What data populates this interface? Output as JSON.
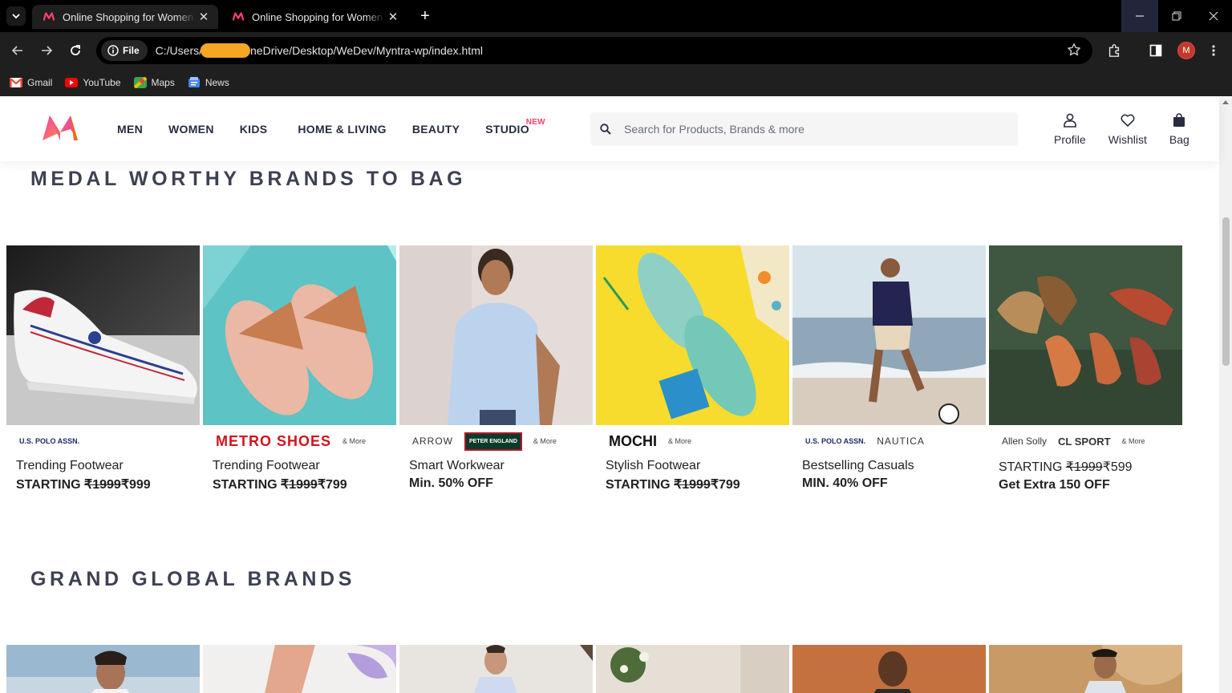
{
  "browser": {
    "tabs": [
      {
        "title": "Online Shopping for Women, M",
        "active": true
      },
      {
        "title": "Online Shopping for Women, M",
        "active": false
      }
    ],
    "address": {
      "chip": "File",
      "url_start": "C:/Users/",
      "url_end": "neDrive/Desktop/WeDev/Myntra-wp/index.html"
    },
    "profile_initial": "M",
    "bookmarks": [
      {
        "label": "Gmail",
        "icon": "gmail-icon",
        "color": "#ea4335"
      },
      {
        "label": "YouTube",
        "icon": "youtube-icon",
        "color": "#ff0000"
      },
      {
        "label": "Maps",
        "icon": "maps-icon",
        "color": "#34a853"
      },
      {
        "label": "News",
        "icon": "news-icon",
        "color": "#4285f4"
      }
    ]
  },
  "site": {
    "accent": "#ff3f6c",
    "nav": [
      {
        "label": "MEN"
      },
      {
        "label": "WOMEN"
      },
      {
        "label": "KIDS"
      },
      {
        "label": "HOME & LIVING"
      },
      {
        "label": "BEAUTY"
      },
      {
        "label": "STUDIO",
        "badge": "NEW"
      }
    ],
    "search_placeholder": "Search for Products, Brands & more",
    "actions": [
      {
        "label": "Profile",
        "icon": "profile-icon"
      },
      {
        "label": "Wishlist",
        "icon": "heart-icon"
      },
      {
        "label": "Bag",
        "icon": "bag-icon"
      }
    ]
  },
  "sections": [
    {
      "title": "MEDAL WORTHY BRANDS TO BAG",
      "cards": [
        {
          "brands": [
            "U.S. POLO ASSN."
          ],
          "more": "",
          "line1": "Trending Footwear",
          "prefix": "STARTING ",
          "old_price": "₹1999",
          "new_price": "₹999",
          "image": "white-sneaker"
        },
        {
          "brands": [
            "METRO SHOES"
          ],
          "more": "& More",
          "line1": "Trending Footwear",
          "prefix": "STARTING ",
          "old_price": "₹1999",
          "new_price": "₹799",
          "image": "woven-sandals"
        },
        {
          "brands": [
            "ARROW",
            "PETER ENGLAND"
          ],
          "more": "& More",
          "line1": "Smart Workwear",
          "prefix": "Min. 50% OFF",
          "old_price": "",
          "new_price": "",
          "image": "blue-shirt-man"
        },
        {
          "brands": [
            "MOCHI"
          ],
          "more": "& More",
          "line1": "Stylish Footwear",
          "prefix": "STARTING ",
          "old_price": "₹1999",
          "new_price": "₹799",
          "image": "glitter-mules"
        },
        {
          "brands": [
            "U.S. POLO ASSN.",
            "NAUTICA"
          ],
          "more": "",
          "line1": "Bestselling Casuals",
          "prefix": "MIN. 40% OFF",
          "old_price": "",
          "new_price": "",
          "image": "beach-man"
        },
        {
          "brands": [
            "Allen Solly",
            "CL SPORT"
          ],
          "more": "& More",
          "line1_prefix": "STARTING ",
          "line1_old": "₹1999",
          "line1_new": "₹599",
          "line1": "",
          "prefix": "Get Extra 150 OFF",
          "old_price": "",
          "new_price": "",
          "image": "heels"
        }
      ]
    },
    {
      "title": "GRAND GLOBAL BRANDS",
      "cards": [
        {
          "image": "man-portrait"
        },
        {
          "image": "legs-lilac"
        },
        {
          "image": "man-shirt"
        },
        {
          "image": "flowers"
        },
        {
          "image": "man-orange"
        },
        {
          "image": "man-sofa"
        }
      ]
    }
  ]
}
